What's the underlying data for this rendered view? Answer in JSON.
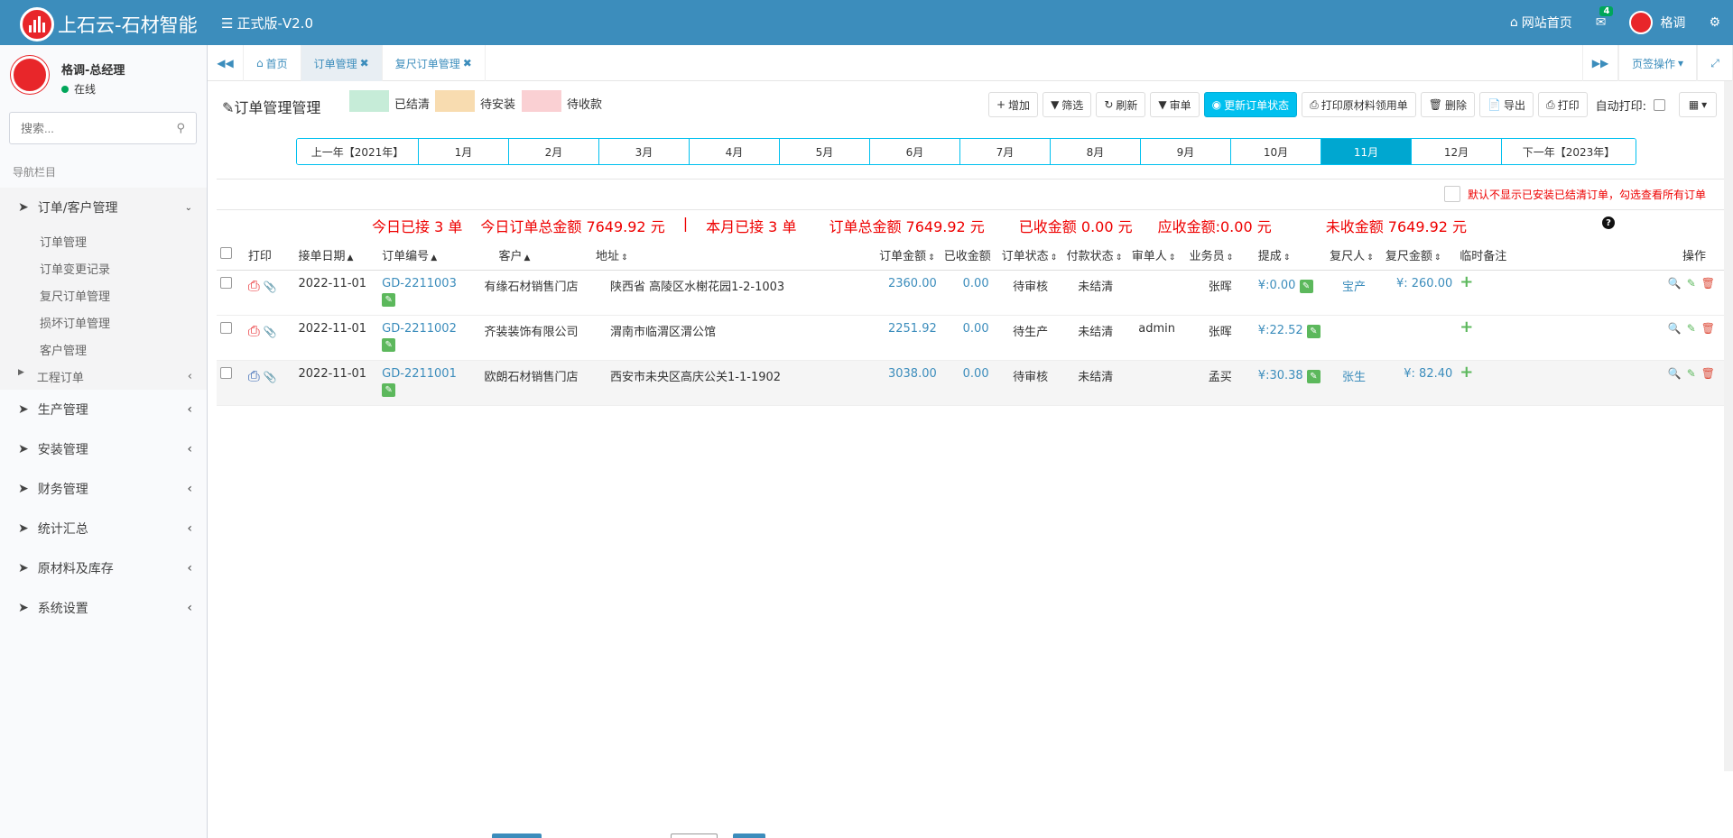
{
  "app": {
    "title": "上石云-石材智能",
    "version": "正式版-V2.0",
    "home_link": "网站首页",
    "mail_count": "4",
    "top_user": "格调",
    "brand_color": "#3c8dbc"
  },
  "sidebar": {
    "user_name": "格调-总经理",
    "user_status": "在线",
    "search_placeholder": "搜索...",
    "nav_header": "导航栏目",
    "groups": [
      {
        "label": "订单/客户管理",
        "subs": [
          "订单管理",
          "订单变更记录",
          "复尺订单管理",
          "损坏订单管理",
          "客户管理"
        ],
        "sub_parent": "工程订单"
      },
      {
        "label": "生产管理"
      },
      {
        "label": "安装管理"
      },
      {
        "label": "财务管理"
      },
      {
        "label": "统计汇总"
      },
      {
        "label": "原材料及库存"
      },
      {
        "label": "系统设置"
      }
    ]
  },
  "tabs": {
    "home": "首页",
    "order_mgmt": "订单管理",
    "remeasure": "复尺订单管理",
    "tab_ops": "页签操作"
  },
  "toolbar": {
    "title": "订单管理管理",
    "legend": [
      {
        "label": "已结清",
        "color": "#c6ecd8"
      },
      {
        "label": "待安装",
        "color": "#f8dcb0"
      },
      {
        "label": "待收款",
        "color": "#fad0d3"
      }
    ],
    "add": "增加",
    "filter": "筛选",
    "refresh": "刷新",
    "review": "审单",
    "update_status": "更新订单状态",
    "print_material": "打印原材料领用单",
    "delete": "删除",
    "export": "导出",
    "print": "打印",
    "auto_print": "自动打印:"
  },
  "months": {
    "prev": "上一年【2021年】",
    "items": [
      "1月",
      "2月",
      "3月",
      "4月",
      "5月",
      "6月",
      "7月",
      "8月",
      "9月",
      "10月",
      "11月",
      "12月"
    ],
    "active": "11月",
    "next": "下一年【2023年】"
  },
  "notice": "默认不显示已安装已结清订单，勾选查看所有订单",
  "stats": {
    "today_count": "今日已接 3 单",
    "today_amount": "今日订单总金额 7649.92 元",
    "sep": "|",
    "month_count": "本月已接 3 单",
    "total_amount": "订单总金额 7649.92 元",
    "received": "已收金额 0.00 元",
    "receivable": "应收金额:0.00 元",
    "unreceived": "未收金额 7649.92 元"
  },
  "table": {
    "headers": {
      "print": "打印",
      "date": "接单日期",
      "no": "订单编号",
      "customer": "客户",
      "address": "地址",
      "amount": "订单金额",
      "received": "已收金额",
      "status": "订单状态",
      "pay_status": "付款状态",
      "reviewer": "审单人",
      "sales": "业务员",
      "commission": "提成",
      "measurer": "复尺人",
      "measure_amount": "复尺金额",
      "note": "临时备注",
      "ops": "操作"
    },
    "rows": [
      {
        "date": "2022-11-01",
        "no": "GD-2211003",
        "customer": "有缘石材销售门店",
        "address": "陕西省 高陵区水榭花园1-2-1003",
        "amount": "2360.00",
        "received": "0.00",
        "status": "待审核",
        "pay_status": "未结清",
        "reviewer": "",
        "sales": "张晖",
        "commission": "¥:0.00",
        "measurer": "宝产",
        "measure_amount": "¥: 260.00",
        "printer_color": "#e8262a"
      },
      {
        "date": "2022-11-01",
        "no": "GD-2211002",
        "customer": "齐装装饰有限公司",
        "address": "渭南市临渭区渭公馆",
        "amount": "2251.92",
        "received": "0.00",
        "status": "待生产",
        "pay_status": "未结清",
        "reviewer": "admin",
        "sales": "张晖",
        "commission": "¥:22.52",
        "measurer": "",
        "measure_amount": "",
        "printer_color": "#e8262a"
      },
      {
        "date": "2022-11-01",
        "no": "GD-2211001",
        "customer": "欧朗石材销售门店",
        "address": "西安市未央区高庆公关1-1-1902",
        "amount": "3038.00",
        "received": "0.00",
        "status": "待审核",
        "pay_status": "未结清",
        "reviewer": "",
        "sales": "孟买",
        "commission": "¥:30.38",
        "measurer": "张生",
        "measure_amount": "¥: 82.40",
        "printer_color": "#2a5db0"
      }
    ]
  }
}
